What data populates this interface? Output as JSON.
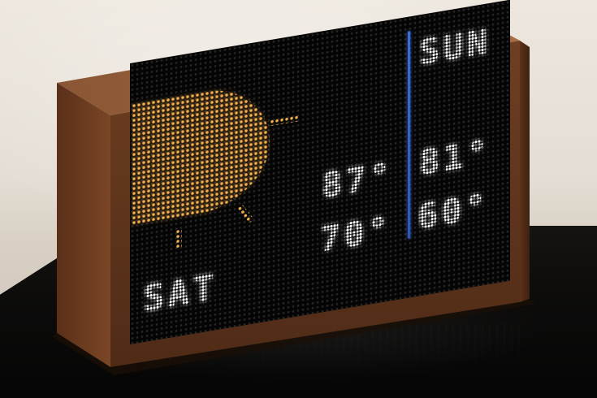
{
  "display": {
    "left_day": "SAT",
    "right_day": "SUN",
    "left_high": "87°",
    "left_low": "70°",
    "right_high": "81°",
    "right_low": "60°",
    "left_weather_icon": "sun-icon"
  },
  "colors": {
    "sun_led": "#f3b04a",
    "text_led": "#ffffff",
    "divider_led": "#3a6fd8",
    "wood": "#6b3f22",
    "panel": "#050505"
  }
}
